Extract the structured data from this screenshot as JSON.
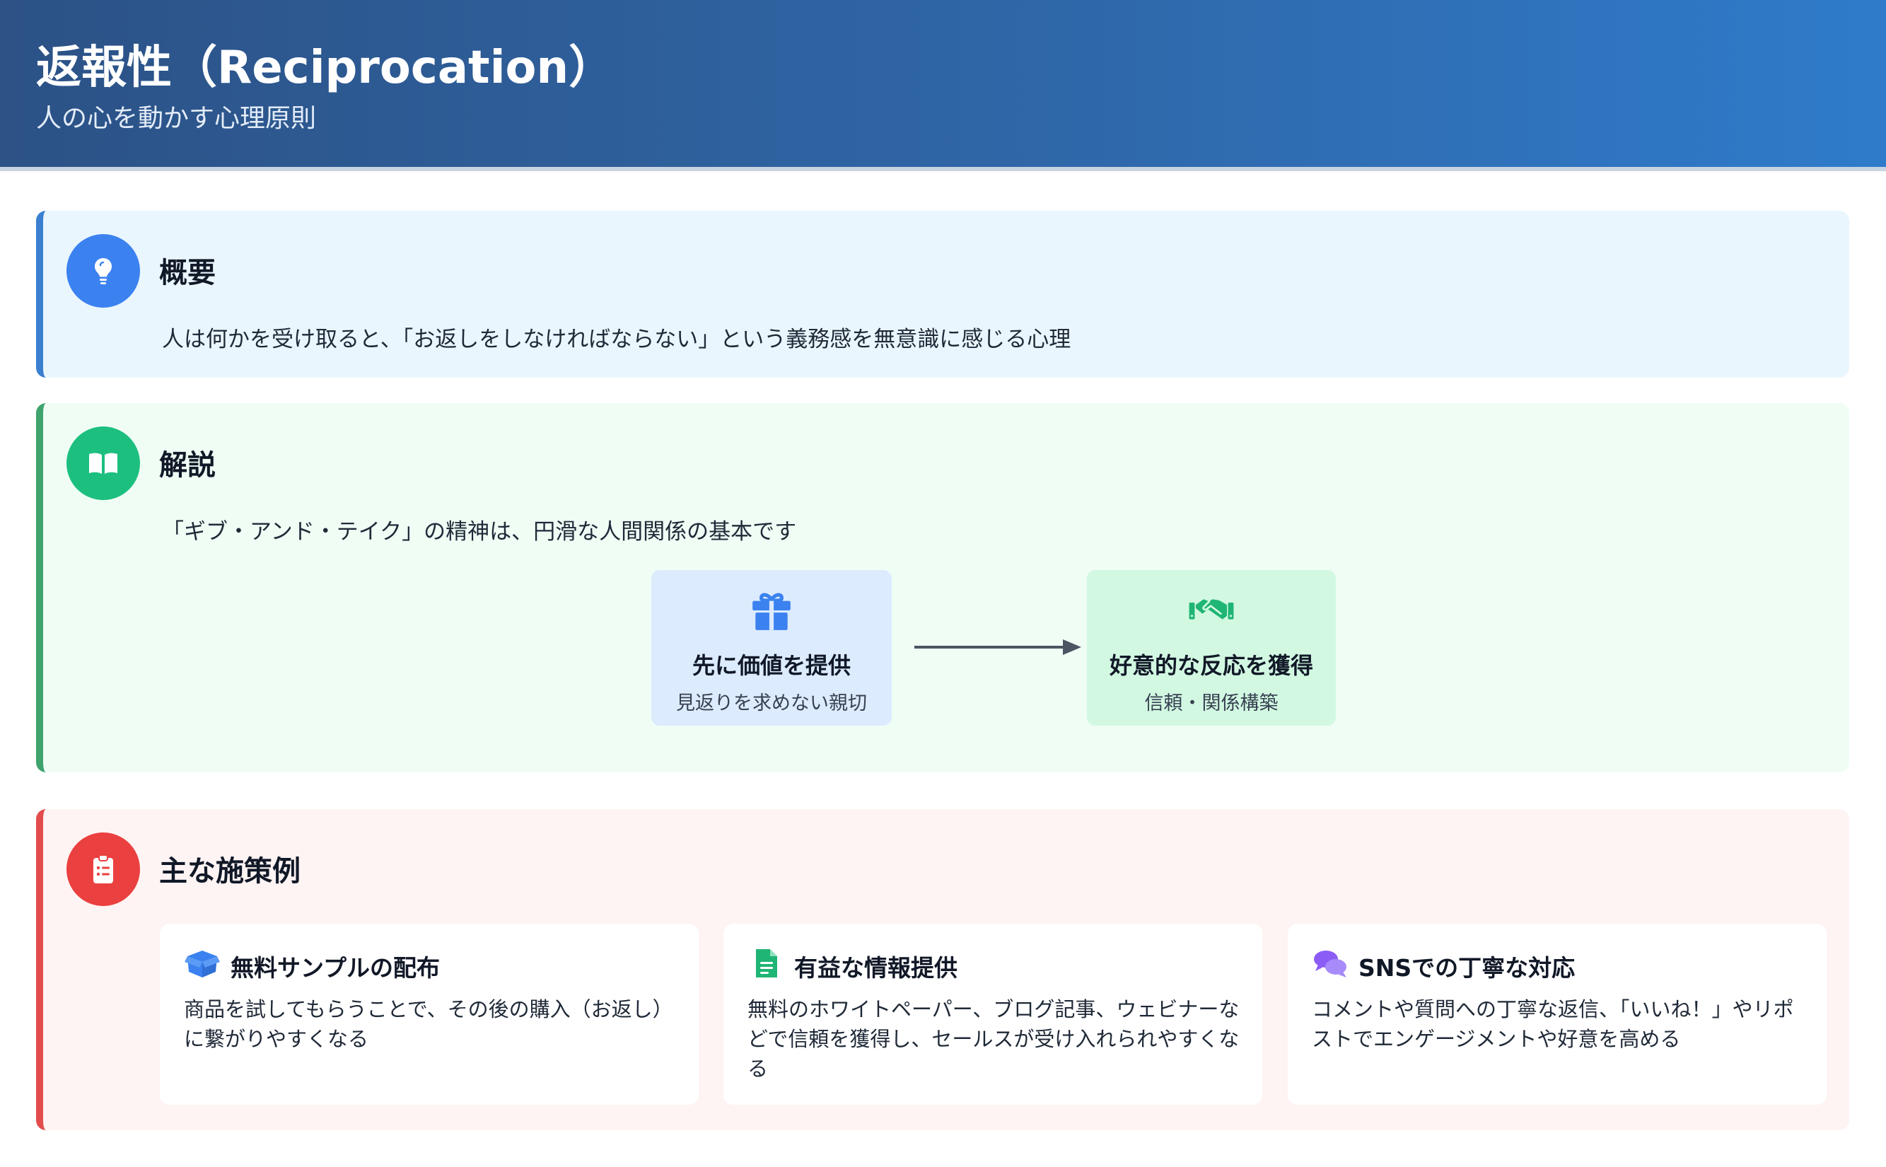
{
  "header": {
    "title": "返報性（Reciprocation）",
    "subtitle": "人の心を動かす心理原則"
  },
  "overview": {
    "icon": "lightbulb-icon",
    "title": "概要",
    "text": "人は何かを受け取ると、「お返しをしなければならない」という義務感を無意識に感じる心理"
  },
  "explanation": {
    "icon": "book-icon",
    "title": "解説",
    "text": "「ギブ・アンド・テイク」の精神は、円滑な人間関係の基本です",
    "flow": {
      "give": {
        "icon": "gift-icon",
        "title": "先に価値を提供",
        "subtitle": "見返りを求めない親切"
      },
      "get": {
        "icon": "handshake-icon",
        "title": "好意的な反応を獲得",
        "subtitle": "信頼・関係構築"
      }
    }
  },
  "measures": {
    "icon": "clipboard-list-icon",
    "title": "主な施策例",
    "cards": [
      {
        "icon": "box-open-icon",
        "title": "無料サンプルの配布",
        "text": "商品を試してもらうことで、その後の購入（お返し）に繋がりやすくなる"
      },
      {
        "icon": "file-document-icon",
        "title": "有益な情報提供",
        "text": "無料のホワイトペーパー、ブログ記事、ウェビナーなどで信頼を獲得し、セールスが受け入れられやすくなる"
      },
      {
        "icon": "comments-icon",
        "title": "SNSでの丁寧な対応",
        "text": "コメントや質問への丁寧な返信、「いいね！」やリポストでエンゲージメントや好意を高める"
      }
    ]
  },
  "colors": {
    "header_start": "#2c5286",
    "header_end": "#2f7bca",
    "overview_accent": "#3a7fd0",
    "explanation_accent": "#3ea36c",
    "measures_accent": "#e34c4c",
    "gift_blue": "#3b82f0",
    "handshake_green": "#1fb574",
    "comments_purple": "#8b5cf6"
  }
}
